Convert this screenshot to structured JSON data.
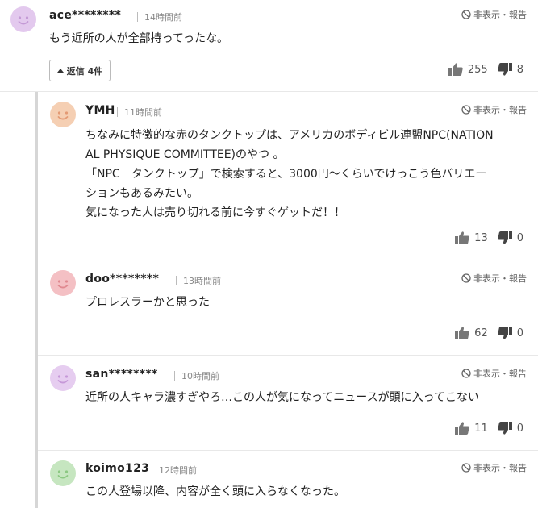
{
  "comment": {
    "avatar_color": "#d9b3e6",
    "user": "ace********",
    "time": "14時間前",
    "actions": "非表示・報告",
    "text": "もう近所の人が全部持ってったな。",
    "reply_button": "返信 4件",
    "likes": "255",
    "dislikes": "8"
  },
  "replies": [
    {
      "avatar_color": "#f3c7a8",
      "face_color": "#e8a07c",
      "user": "YMH",
      "time": "11時間前",
      "actions": "非表示・報告",
      "text": "ちなみに特徴的な赤のタンクトップは、アメリカのボディビル連盟NPC(NATION\nAL PHYSIQUE COMMITTEE)のやつ 。\n「NPC　タンクトップ」で検索すると、3000円〜くらいでけっこう色バリエー\nションもあるみたい。\n気になった人は売り切れる前に今すぐゲットだ！！",
      "likes": "13",
      "dislikes": "0"
    },
    {
      "avatar_color": "#f2b9bd",
      "face_color": "#e08a90",
      "user": "doo********",
      "time": "13時間前",
      "actions": "非表示・報告",
      "text": "プロレスラーかと思った",
      "likes": "62",
      "dislikes": "0"
    },
    {
      "avatar_color": "#e2c4ec",
      "face_color": "#c89ad8",
      "user": "san********",
      "time": "10時間前",
      "actions": "非表示・報告",
      "text": "近所の人キャラ濃すぎやろ…この人が気になってニュースが頭に入ってこない",
      "likes": "11",
      "dislikes": "0"
    },
    {
      "avatar_color": "#c2e4bc",
      "face_color": "#8cc983",
      "user": "koimo123",
      "time": "12時間前",
      "actions": "非表示・報告",
      "text": "この人登場以降、内容が全く頭に入らなくなった。",
      "likes": "",
      "dislikes": ""
    }
  ]
}
